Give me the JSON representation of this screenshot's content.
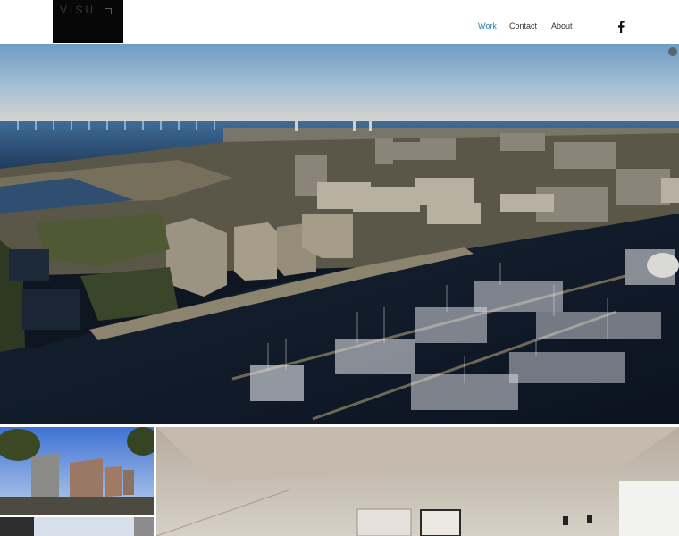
{
  "header": {
    "logo": "VISU",
    "nav": [
      {
        "label": "Work",
        "active": true
      },
      {
        "label": "Contact",
        "active": false
      },
      {
        "label": "About",
        "active": false
      }
    ],
    "social_icon": "facebook-icon"
  },
  "hero": {
    "description_icon": "aerial-harbor-photo"
  },
  "gallery": {
    "items": [
      {
        "icon": "building-render-photo"
      },
      {
        "icon": "building-exterior-photo"
      },
      {
        "icon": "interior-render-photo"
      }
    ]
  },
  "colors": {
    "accent": "#2a7fb8",
    "logo_bg": "#070707",
    "text": "#333333"
  }
}
